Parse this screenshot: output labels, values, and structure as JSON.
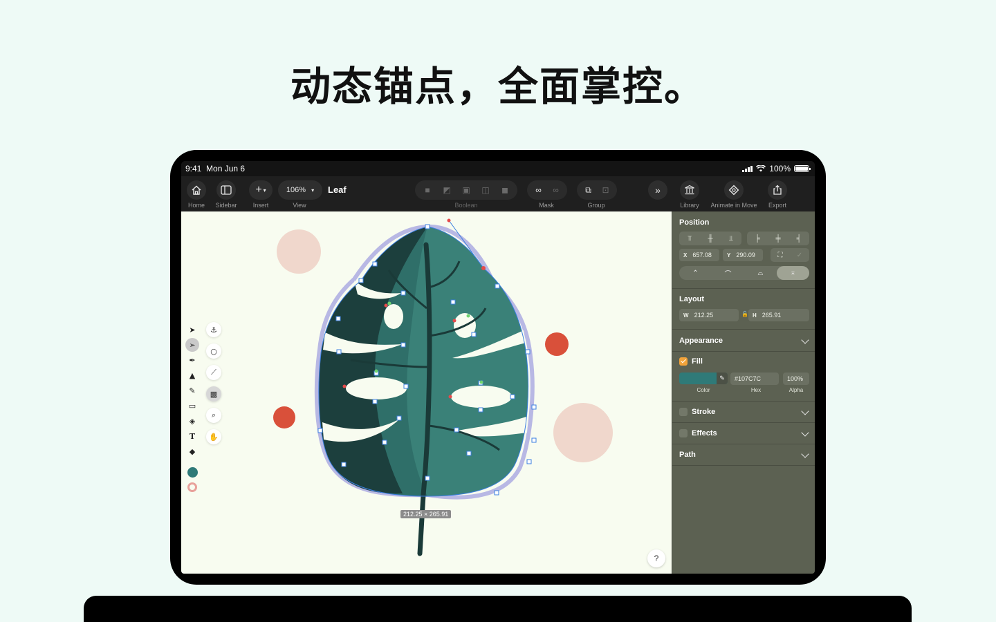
{
  "headline": "动态锚点，全面掌控。",
  "status": {
    "time": "9:41",
    "date": "Mon Jun 6",
    "battery": "100%"
  },
  "toolbar": {
    "home": "Home",
    "sidebar": "Sidebar",
    "insert": "Insert",
    "view": "View",
    "zoom": "106%",
    "doc_title": "Leaf",
    "boolean": "Boolean",
    "mask": "Mask",
    "group": "Group",
    "library": "Library",
    "animate": "Animate in Move",
    "export": "Export"
  },
  "canvas": {
    "dimension_tag": "212.25 × 265.91",
    "help": "?",
    "fill_color": "#107C7C"
  },
  "inspector": {
    "position": {
      "title": "Position",
      "x_label": "X",
      "x_value": "657.08",
      "y_label": "Y",
      "y_value": "290.09"
    },
    "layout": {
      "title": "Layout",
      "w_label": "W",
      "w_value": "212.25",
      "h_label": "H",
      "h_value": "265.91"
    },
    "appearance": {
      "title": "Appearance"
    },
    "fill": {
      "label": "Fill",
      "hex": "#107C7C",
      "alpha": "100%",
      "color_label": "Color",
      "hex_label": "Hex",
      "alpha_label": "Alpha"
    },
    "stroke": {
      "label": "Stroke"
    },
    "effects": {
      "label": "Effects"
    },
    "path": {
      "title": "Path"
    }
  },
  "icons": [
    "home-icon",
    "sidebar-icon",
    "plus-icon",
    "chevron-down-icon",
    "boolean-union-icon",
    "mask-icon",
    "group-icon",
    "forward-icon",
    "library-icon",
    "animate-icon",
    "export-icon"
  ]
}
